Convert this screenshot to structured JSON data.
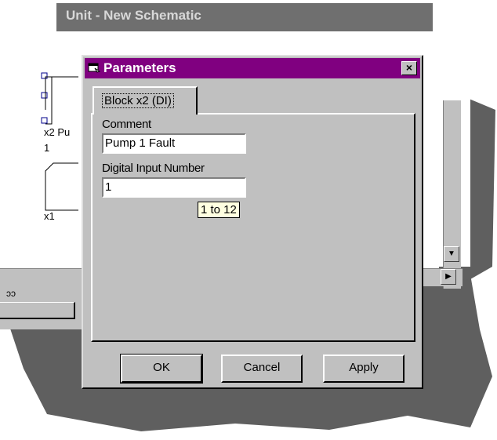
{
  "background": {
    "window_title": "Unit - New Schematic",
    "blocks": [
      {
        "label": "x2 Pu",
        "sub": "1"
      },
      {
        "label": "x1"
      }
    ],
    "status_fragment": "ɔɔ"
  },
  "dialog": {
    "title": "Parameters",
    "close_label": "×",
    "tab_label": "Block x2 (DI)",
    "comment_label": "Comment",
    "comment_value": "Pump 1 Fault",
    "input_label": "Digital Input Number",
    "input_value": "1",
    "tooltip": "1 to 12",
    "buttons": {
      "ok": "OK",
      "cancel": "Cancel",
      "apply": "Apply"
    }
  },
  "colors": {
    "titlebar": "#800080",
    "face": "#c0c0c0",
    "tooltip": "#ffffe1"
  }
}
